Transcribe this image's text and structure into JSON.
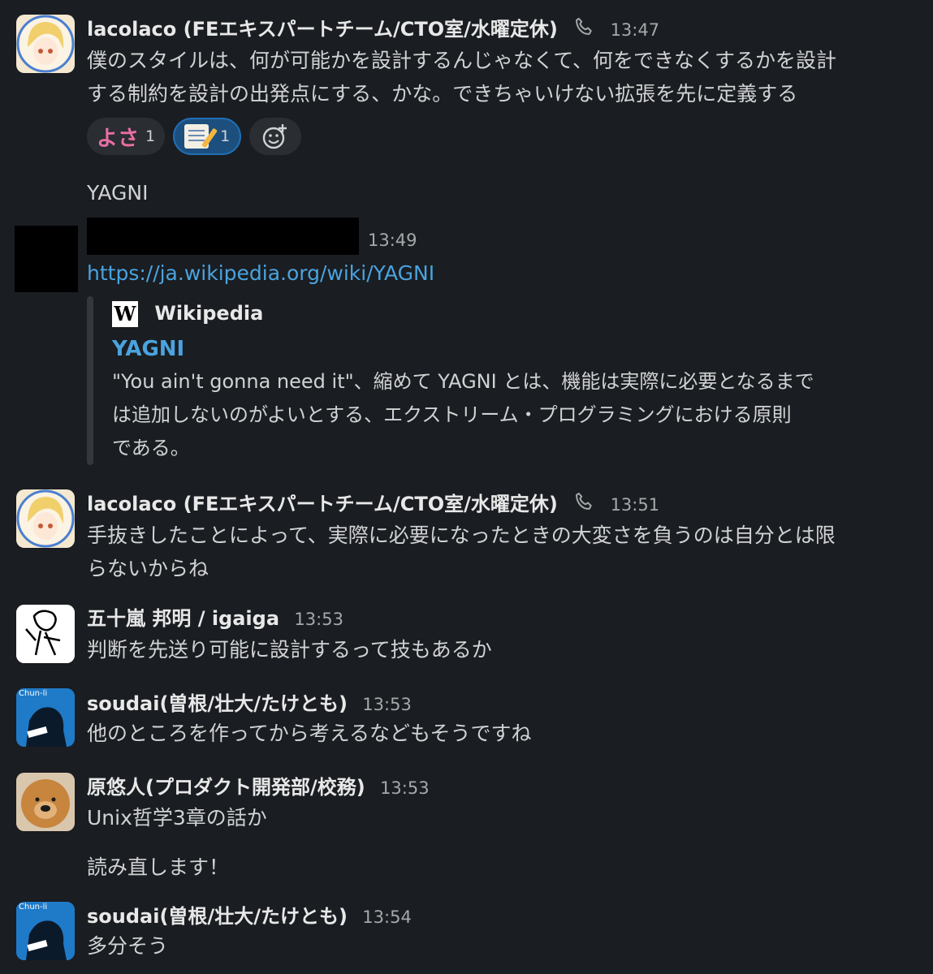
{
  "messages": [
    {
      "author": "lacolaco (FEエキスパートチーム/CTO室/水曜定休)",
      "time": "13:47",
      "lines": [
        "僕のスタイルは、何が可能かを設計するんじゃなくて、何をできなくするかを設計",
        "する制約を設計の出発点にする、かな。できちゃいけない拡張を先に定義する"
      ],
      "reactions": [
        {
          "emoji": "よさ",
          "count": "1"
        },
        {
          "emoji": "memo",
          "count": "1"
        }
      ]
    },
    {
      "text": "YAGNI"
    },
    {
      "author": "",
      "time": "13:49",
      "link": "https://ja.wikipedia.org/wiki/YAGNI",
      "unfurl": {
        "site": "Wikipedia",
        "title": "YAGNI",
        "lines": [
          "\"You ain't gonna need it\"、縮めて YAGNI とは、機能は実際に必要となるまで",
          "は追加しないのがよいとする、エクストリーム・プログラミングにおける原則",
          "である。"
        ]
      }
    },
    {
      "author": "lacolaco (FEエキスパートチーム/CTO室/水曜定休)",
      "time": "13:51",
      "lines": [
        "手抜きしたことによって、実際に必要になったときの大変さを負うのは自分とは限",
        "らないからね"
      ]
    },
    {
      "author": "五十嵐 邦明 / igaiga",
      "time": "13:53",
      "text": "判断を先送り可能に設計するって技もあるか"
    },
    {
      "author": "soudai(曽根/壮大/たけとも)",
      "time": "13:53",
      "text": "他のところを作ってから考えるなどもそうですね",
      "avatar_label": "Chun-li"
    },
    {
      "author": "原悠人(プロダクト開発部/校務)",
      "time": "13:53",
      "text": "Unix哲学3章の話か"
    },
    {
      "text": "読み直します！"
    },
    {
      "author": "soudai(曽根/壮大/たけとも)",
      "time": "13:54",
      "text": "多分そう",
      "avatar_label": "Chun-li"
    }
  ],
  "colors": {
    "background": "#1a1d21",
    "link": "#4aa3df",
    "reaction_active": "#1d4f7e"
  }
}
